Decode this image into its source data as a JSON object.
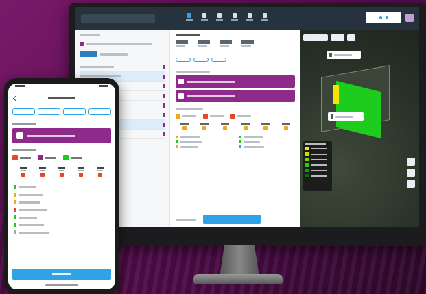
{
  "colors": {
    "brand_purple": "#8e2a8a",
    "accent_blue": "#2ea3e6",
    "topbar_dark": "#26323d",
    "map_green": "#1ecc1e",
    "map_yellow": "#f5e500",
    "warn_orange": "#f0a81a",
    "alert_red": "#e04a2a"
  },
  "desktop": {
    "nav_icons": [
      "fields-icon",
      "map-icon",
      "crop-icon",
      "weather-icon",
      "report-icon",
      "settings-icon"
    ],
    "active_nav_index": 0
  },
  "phone": {
    "grid_columns": 5,
    "legend_rows": 7
  }
}
